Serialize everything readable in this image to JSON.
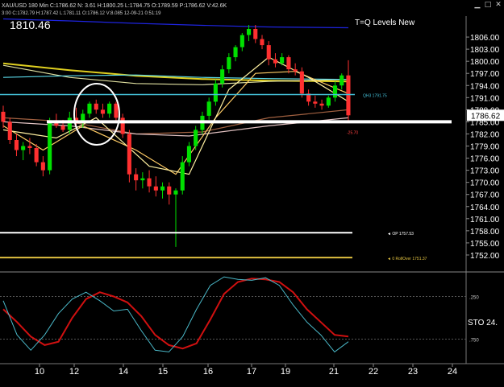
{
  "header": {
    "line1": "XAU/USD 180 Min C:1786.62 N: 3.61 H:1800.25 L:1784.75 O:1789.59 P:1786.62 V:42.6K",
    "line2": "3:00 C:1782.79 H:1787.42 L:1781.11 O:1786.12 V:8.085 12-09-21 0:51:19"
  },
  "window_controls": [
    "minimize-icon",
    "maximize-icon",
    "close-icon"
  ],
  "crosshair_value": "1810.46",
  "study_title": "T=Q Levels New",
  "chart_data": [
    {
      "type": "candlestick",
      "title": "XAU/USD 180 Min",
      "ylim": [
        1749,
        1810
      ],
      "ytick_labels": [
        "1806.00",
        "1803.00",
        "1800.00",
        "1797.00",
        "1794.00",
        "1791.00",
        "1788.00",
        "1785.00",
        "1782.00",
        "1779.00",
        "1776.00",
        "1773.00",
        "1770.00",
        "1767.00",
        "1764.00",
        "1761.00",
        "1758.00",
        "1755.00",
        "1752.00"
      ],
      "xtick_labels": [
        "10",
        "12",
        "14",
        "15",
        "16",
        "17",
        "19",
        "21",
        "22",
        "23",
        "24"
      ],
      "last_price": "1786.62",
      "last_price_color": "#ff0000",
      "up_color": "#00e000",
      "down_color": "#ff3030",
      "candles": [
        {
          "o": 1787.5,
          "h": 1789.0,
          "l": 1783.5,
          "c": 1785.0
        },
        {
          "o": 1785.0,
          "h": 1786.0,
          "l": 1779.5,
          "c": 1780.5
        },
        {
          "o": 1780.5,
          "h": 1782.0,
          "l": 1776.5,
          "c": 1778.0
        },
        {
          "o": 1778.0,
          "h": 1780.0,
          "l": 1775.5,
          "c": 1779.0
        },
        {
          "o": 1779.0,
          "h": 1781.0,
          "l": 1777.0,
          "c": 1778.5
        },
        {
          "o": 1778.5,
          "h": 1779.5,
          "l": 1774.0,
          "c": 1775.0
        },
        {
          "o": 1775.0,
          "h": 1776.5,
          "l": 1771.5,
          "c": 1773.0
        },
        {
          "o": 1773.0,
          "h": 1786.0,
          "l": 1772.0,
          "c": 1785.0
        },
        {
          "o": 1785.0,
          "h": 1787.0,
          "l": 1783.5,
          "c": 1784.0
        },
        {
          "o": 1784.0,
          "h": 1785.5,
          "l": 1782.5,
          "c": 1783.0
        },
        {
          "o": 1783.0,
          "h": 1787.5,
          "l": 1782.0,
          "c": 1786.0
        },
        {
          "o": 1786.0,
          "h": 1788.5,
          "l": 1784.0,
          "c": 1785.0
        },
        {
          "o": 1785.0,
          "h": 1788.0,
          "l": 1783.5,
          "c": 1787.0
        },
        {
          "o": 1787.0,
          "h": 1790.0,
          "l": 1786.0,
          "c": 1789.5
        },
        {
          "o": 1789.5,
          "h": 1790.5,
          "l": 1787.0,
          "c": 1788.0
        },
        {
          "o": 1788.0,
          "h": 1789.5,
          "l": 1786.0,
          "c": 1787.0
        },
        {
          "o": 1787.0,
          "h": 1790.0,
          "l": 1786.0,
          "c": 1789.5
        },
        {
          "o": 1789.5,
          "h": 1790.0,
          "l": 1785.0,
          "c": 1786.0
        },
        {
          "o": 1786.0,
          "h": 1787.0,
          "l": 1781.0,
          "c": 1782.0
        },
        {
          "o": 1782.0,
          "h": 1783.0,
          "l": 1770.0,
          "c": 1772.0
        },
        {
          "o": 1772.0,
          "h": 1773.5,
          "l": 1768.0,
          "c": 1770.5
        },
        {
          "o": 1770.5,
          "h": 1772.5,
          "l": 1768.5,
          "c": 1771.0
        },
        {
          "o": 1771.0,
          "h": 1773.0,
          "l": 1767.5,
          "c": 1769.0
        },
        {
          "o": 1769.0,
          "h": 1771.5,
          "l": 1766.5,
          "c": 1768.0
        },
        {
          "o": 1768.0,
          "h": 1770.0,
          "l": 1766.0,
          "c": 1769.0
        },
        {
          "o": 1769.0,
          "h": 1770.0,
          "l": 1764.5,
          "c": 1767.0
        },
        {
          "o": 1767.0,
          "h": 1768.5,
          "l": 1754.0,
          "c": 1768.0
        },
        {
          "o": 1768.0,
          "h": 1776.5,
          "l": 1767.0,
          "c": 1775.0
        },
        {
          "o": 1775.0,
          "h": 1780.0,
          "l": 1774.0,
          "c": 1779.0
        },
        {
          "o": 1779.0,
          "h": 1784.0,
          "l": 1778.0,
          "c": 1783.0
        },
        {
          "o": 1783.0,
          "h": 1787.5,
          "l": 1782.0,
          "c": 1786.5
        },
        {
          "o": 1786.5,
          "h": 1791.0,
          "l": 1785.5,
          "c": 1790.0
        },
        {
          "o": 1790.0,
          "h": 1795.5,
          "l": 1789.0,
          "c": 1794.5
        },
        {
          "o": 1794.5,
          "h": 1799.0,
          "l": 1793.5,
          "c": 1798.0
        },
        {
          "o": 1798.0,
          "h": 1802.0,
          "l": 1797.0,
          "c": 1801.0
        },
        {
          "o": 1801.0,
          "h": 1804.0,
          "l": 1800.0,
          "c": 1803.5
        },
        {
          "o": 1803.5,
          "h": 1807.0,
          "l": 1802.5,
          "c": 1806.5
        },
        {
          "o": 1806.5,
          "h": 1809.0,
          "l": 1805.0,
          "c": 1808.0
        },
        {
          "o": 1808.0,
          "h": 1809.0,
          "l": 1804.5,
          "c": 1805.5
        },
        {
          "o": 1805.5,
          "h": 1806.5,
          "l": 1803.0,
          "c": 1804.0
        },
        {
          "o": 1804.0,
          "h": 1805.0,
          "l": 1799.0,
          "c": 1800.5
        },
        {
          "o": 1800.5,
          "h": 1802.0,
          "l": 1798.5,
          "c": 1799.5
        },
        {
          "o": 1799.5,
          "h": 1802.0,
          "l": 1799.0,
          "c": 1801.0
        },
        {
          "o": 1801.0,
          "h": 1801.5,
          "l": 1797.0,
          "c": 1798.0
        },
        {
          "o": 1798.0,
          "h": 1799.5,
          "l": 1796.5,
          "c": 1797.5
        },
        {
          "o": 1797.5,
          "h": 1798.5,
          "l": 1791.0,
          "c": 1792.0
        },
        {
          "o": 1792.0,
          "h": 1793.0,
          "l": 1789.0,
          "c": 1790.0
        },
        {
          "o": 1790.0,
          "h": 1791.5,
          "l": 1788.5,
          "c": 1789.5
        },
        {
          "o": 1789.5,
          "h": 1790.5,
          "l": 1788.0,
          "c": 1789.0
        },
        {
          "o": 1789.0,
          "h": 1791.5,
          "l": 1788.5,
          "c": 1791.0
        },
        {
          "o": 1791.0,
          "h": 1795.0,
          "l": 1790.0,
          "c": 1794.0
        },
        {
          "o": 1794.0,
          "h": 1797.0,
          "l": 1793.0,
          "c": 1796.5
        },
        {
          "o": 1796.5,
          "h": 1800.25,
          "l": 1784.75,
          "c": 1786.62
        }
      ],
      "ma_lines": [
        {
          "color": "#1e24e0",
          "values": [
            [
              0,
              1810.5
            ],
            [
              10,
              1810.0
            ],
            [
              20,
              1809.4
            ],
            [
              30,
              1808.9
            ],
            [
              40,
              1808.5
            ],
            [
              52,
              1808.3
            ]
          ]
        },
        {
          "color": "#e0d020",
          "values": [
            [
              0,
              1799.5
            ],
            [
              10,
              1797.8
            ],
            [
              20,
              1796.4
            ],
            [
              30,
              1795.6
            ],
            [
              40,
              1795.2
            ],
            [
              52,
              1795.0
            ]
          ]
        },
        {
          "color": "#e0e0a0",
          "values": [
            [
              0,
              1799.0
            ],
            [
              10,
              1796.0
            ],
            [
              20,
              1794.5
            ],
            [
              30,
              1794.2
            ],
            [
              40,
              1795.0
            ],
            [
              52,
              1795.5
            ]
          ]
        },
        {
          "color": "#5ad8e8",
          "values": [
            [
              0,
              1796.0
            ],
            [
              10,
              1796.4
            ],
            [
              20,
              1796.6
            ],
            [
              30,
              1796.0
            ],
            [
              40,
              1795.7
            ],
            [
              52,
              1795.5
            ]
          ]
        },
        {
          "color": "#a06040",
          "values": [
            [
              0,
              1786.0
            ],
            [
              10,
              1785.0
            ],
            [
              20,
              1782.0
            ],
            [
              30,
              1782.5
            ],
            [
              40,
              1786.0
            ],
            [
              52,
              1788.0
            ]
          ]
        },
        {
          "color": "#e0c0c0",
          "values": [
            [
              0,
              1785.0
            ],
            [
              10,
              1784.0
            ],
            [
              20,
              1782.0
            ],
            [
              28,
              1781.5
            ],
            [
              40,
              1784.0
            ],
            [
              52,
              1786.0
            ]
          ]
        },
        {
          "color": "#ffcc66",
          "values": [
            [
              0,
              1784.0
            ],
            [
              6,
              1778.0
            ],
            [
              12,
              1784.0
            ],
            [
              20,
              1778.0
            ],
            [
              26,
              1772.0
            ],
            [
              32,
              1786.0
            ],
            [
              38,
              1797.0
            ],
            [
              44,
              1797.5
            ],
            [
              52,
              1792.0
            ]
          ]
        },
        {
          "color": "#fff0a0",
          "values": [
            [
              0,
              1783.0
            ],
            [
              8,
              1781.0
            ],
            [
              14,
              1786.0
            ],
            [
              22,
              1774.0
            ],
            [
              28,
              1772.0
            ],
            [
              34,
              1793.0
            ],
            [
              40,
              1801.0
            ],
            [
              46,
              1796.0
            ],
            [
              52,
              1790.0
            ]
          ]
        }
      ],
      "levels": [
        {
          "price": 1791.75,
          "color": "#44c0d8",
          "label": "QH3 1791.75"
        },
        {
          "price": 1785.0,
          "color": "#ffffff",
          "label": ""
        },
        {
          "price": 1757.53,
          "color": "#ffffff",
          "label": "OP 1757.53"
        },
        {
          "price": 1751.37,
          "color": "#e0c040",
          "label": "0 RollOver 1751.37"
        }
      ],
      "annotations": [
        "-25.70"
      ]
    },
    {
      "type": "line",
      "title": "STO",
      "value_label": "STO 24.",
      "ylim": [
        0,
        100
      ],
      "ytick_labels": [
        ".250",
        ".750"
      ],
      "series": [
        {
          "color": "#d01010",
          "values": [
            60,
            45,
            28,
            18,
            22,
            50,
            72,
            80,
            75,
            68,
            52,
            30,
            18,
            14,
            20,
            48,
            78,
            92,
            96,
            95,
            92,
            80,
            60,
            45,
            30,
            28
          ]
        },
        {
          "color": "#4ab8c8",
          "values": [
            70,
            30,
            12,
            30,
            55,
            72,
            80,
            70,
            58,
            60,
            35,
            12,
            10,
            28,
            60,
            88,
            98,
            95,
            94,
            97,
            88,
            65,
            45,
            30,
            10,
            22
          ]
        }
      ]
    }
  ]
}
